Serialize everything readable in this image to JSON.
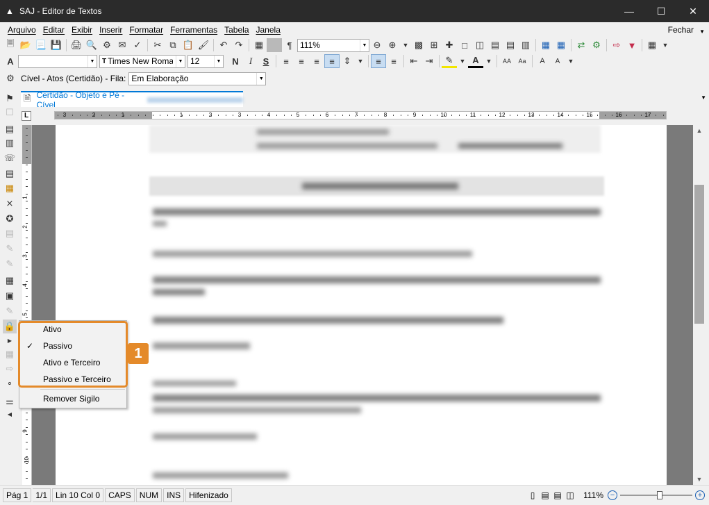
{
  "window": {
    "title": "SAJ - Editor de Textos"
  },
  "menu": {
    "items": [
      "Arquivo",
      "Editar",
      "Exibir",
      "Inserir",
      "Formatar",
      "Ferramentas",
      "Tabela",
      "Janela"
    ],
    "close_label": "Fechar"
  },
  "toolbar1": {
    "zoom_value": "111%"
  },
  "toolbar2": {
    "style_value": "",
    "font_name": "Times New Roman",
    "font_size": "12"
  },
  "fila": {
    "label": "Cível - Atos (Certidão) - Fila:",
    "value": "Em Elaboração"
  },
  "document_tab": {
    "label": "Certidão - Objeto e Pé - Cível"
  },
  "ruler": {
    "numbers": [
      "3",
      "2",
      "1",
      "1",
      "2",
      "3",
      "4",
      "5",
      "6",
      "7",
      "8",
      "9",
      "10",
      "11",
      "12",
      "13",
      "14",
      "15",
      "16",
      "17"
    ],
    "vnumbers": [
      "1",
      "2",
      "3",
      "4",
      "5",
      "6",
      "7",
      "8",
      "9",
      "10"
    ]
  },
  "context_menu": {
    "items": [
      "Ativo",
      "Passivo",
      "Ativo e Terceiro",
      "Passivo e Terceiro"
    ],
    "checked": "Passivo",
    "remove_label": "Remover Sigilo"
  },
  "callout": {
    "number": "1"
  },
  "status": {
    "page": "Pág 1",
    "pages": "1/1",
    "position": "Lin 10  Col 0",
    "caps": "CAPS",
    "num": "NUM",
    "ins": "INS",
    "hyphen": "Hifenizado",
    "zoom": "111%",
    "zoom_fraction": 0.55
  }
}
